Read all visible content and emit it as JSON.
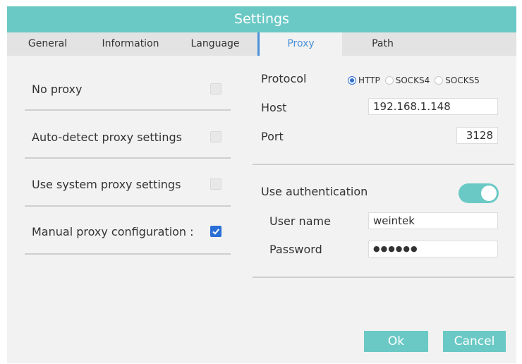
{
  "window": {
    "title": "Settings"
  },
  "tabs": [
    {
      "label": "General",
      "active": false
    },
    {
      "label": "Information",
      "active": false
    },
    {
      "label": "Language",
      "active": false
    },
    {
      "label": "Proxy",
      "active": true
    },
    {
      "label": "Path",
      "active": false
    }
  ],
  "proxy_modes": [
    {
      "label": "No proxy",
      "checked": false
    },
    {
      "label": "Auto-detect proxy settings",
      "checked": false
    },
    {
      "label": "Use system proxy settings",
      "checked": false
    },
    {
      "label": "Manual proxy configuration :",
      "checked": true
    }
  ],
  "manual": {
    "protocol_label": "Protocol",
    "protocols": [
      {
        "label": "HTTP",
        "selected": true
      },
      {
        "label": "SOCKS4",
        "selected": false
      },
      {
        "label": "SOCKS5",
        "selected": false
      }
    ],
    "host_label": "Host",
    "host_value": "192.168.1.148",
    "port_label": "Port",
    "port_value": "3128"
  },
  "auth": {
    "label": "Use authentication",
    "enabled": true,
    "username_label": "User name",
    "username_value": "weintek",
    "password_label": "Password",
    "password_value": "●●●●●●"
  },
  "buttons": {
    "ok": "Ok",
    "cancel": "Cancel"
  },
  "colors": {
    "accent": "#6bc9c5",
    "active_tab": "#4a90d9",
    "checkbox_checked": "#2a6fd6",
    "background": "#f2f2f2"
  }
}
